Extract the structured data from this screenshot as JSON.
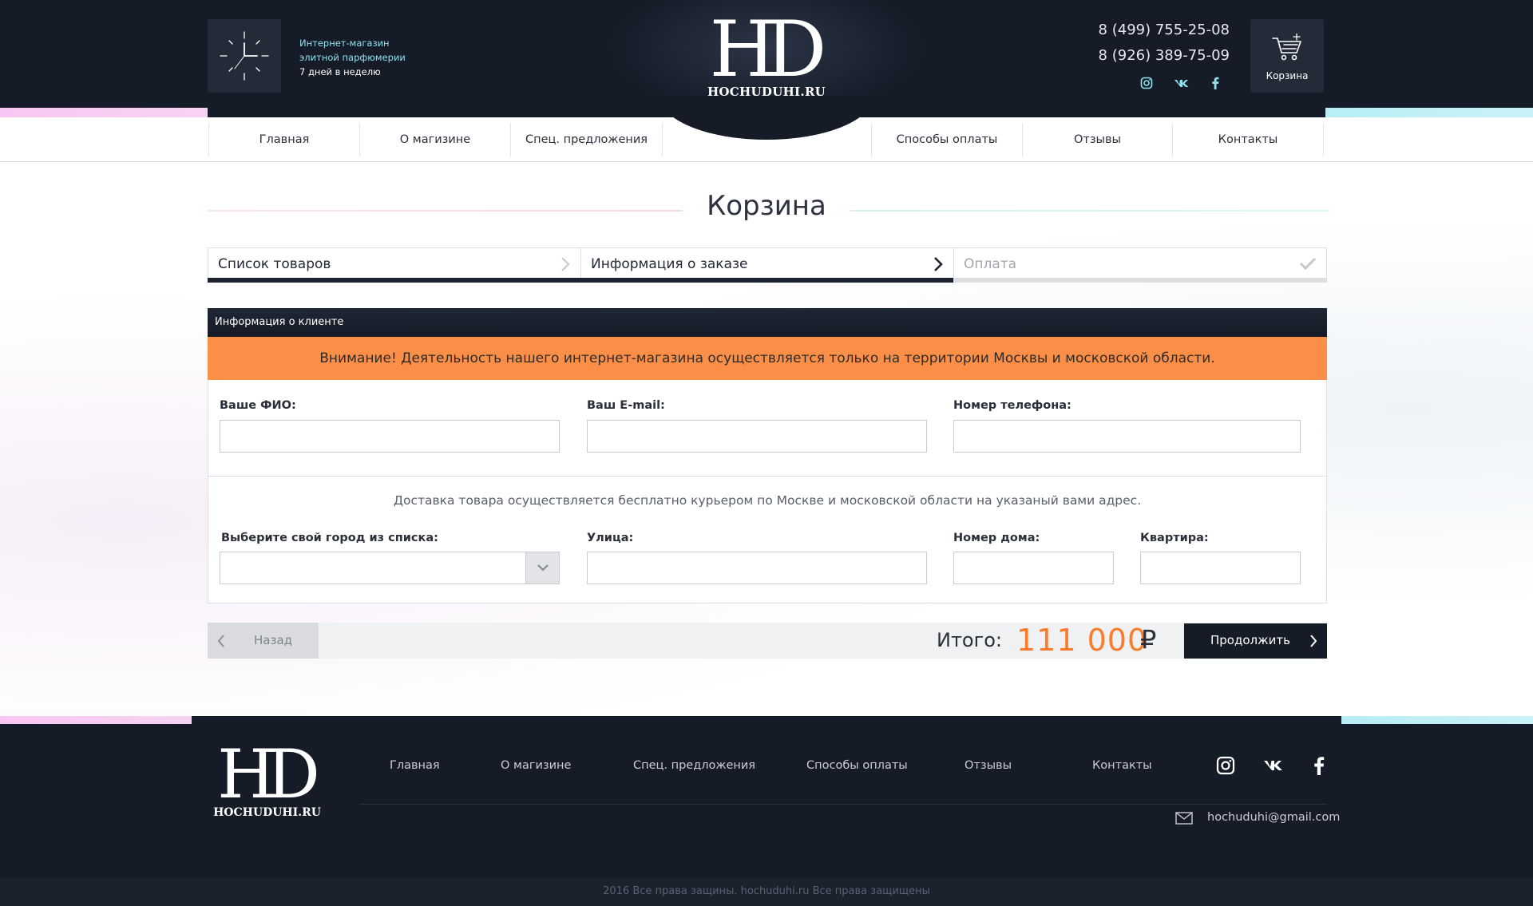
{
  "header": {
    "tagline": [
      "Интернет-магазин",
      "элитной парфюмерии",
      "7 дней в неделю"
    ],
    "logo_mark": "HD",
    "logo_name": "HOCHUDUHI.RU",
    "phones": [
      "8 (499) 755-25-08",
      "8 (926) 389-75-09"
    ],
    "socials": [
      "instagram-icon",
      "vk-icon",
      "facebook-icon"
    ],
    "cart_label": "Корзина"
  },
  "nav": {
    "items": [
      "Главная",
      "О магизине",
      "Спец. предложения",
      "Способы оплаты",
      "Отзывы",
      "Контакты"
    ]
  },
  "page": {
    "title": "Корзина",
    "steps": [
      {
        "label": "Список товаров",
        "state": "done"
      },
      {
        "label": "Информация о заказе",
        "state": "active"
      },
      {
        "label": "Оплата",
        "state": "pending"
      }
    ]
  },
  "form": {
    "section_title": "Информация о клиенте",
    "alert": "Внимание! Деятельность нашего интернет-магазина осуществляется только на территории Москвы и московской области.",
    "name_label": "Ваше ФИО:",
    "name_value": "",
    "email_label": "Ваш E-mail:",
    "email_value": "",
    "phone_label": "Номер телефона:",
    "phone_value": "",
    "delivery_note": "Доставка товара осуществляется бесплатно курьером по Москве и московской области на указаный вами адрес.",
    "city_label": "Выберите свой город из списка:",
    "city_value": "",
    "street_label": "Улица:",
    "street_value": "",
    "house_label": "Номер дома:",
    "house_value": "",
    "apt_label": "Квартира:",
    "apt_value": ""
  },
  "footer_bar": {
    "back_label": "Назад",
    "total_label": "Итого:",
    "total_value": "111 000",
    "currency": "₽",
    "continue_label": "Продолжить"
  },
  "footer": {
    "logo_mark": "HD",
    "logo_name": "HOCHUDUHI.RU",
    "nav": [
      "Главная",
      "О магизине",
      "Спец. предложения",
      "Способы оплаты",
      "Отзывы",
      "Контакты"
    ],
    "socials": [
      "instagram-icon",
      "vk-icon",
      "facebook-icon"
    ],
    "email": "hochuduhi@gmail.com",
    "copyright": "2016 Все права защины. hochuduhi.ru Все права защищены"
  },
  "colors": {
    "dark": "#151b27",
    "accent_orange": "#fb7c2a",
    "alert_bg": "#fc8f48",
    "tagline_cyan": "#8fe1ee"
  }
}
